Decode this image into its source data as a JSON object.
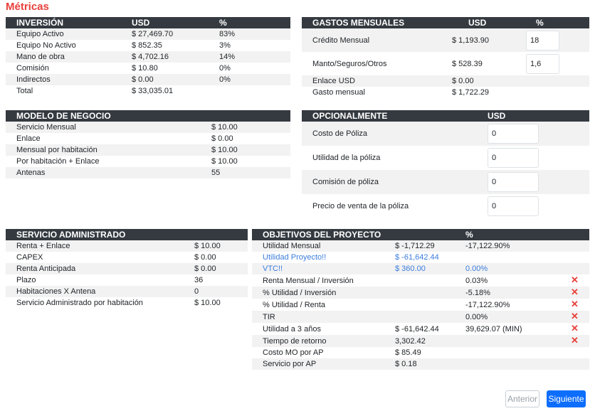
{
  "page_title": "Métricas",
  "inversion": {
    "headers": [
      "INVERSIÓN",
      "USD",
      "%"
    ],
    "rows": [
      [
        "Equipo Activo",
        "$ 27,469.70",
        "83%"
      ],
      [
        "Equipo No Activo",
        "$ 852.35",
        "3%"
      ],
      [
        "Mano de obra",
        "$ 4,702.16",
        "14%"
      ],
      [
        "Comisión",
        "$ 10.80",
        "0%"
      ],
      [
        "Indirectos",
        "$ 0.00",
        "0%"
      ],
      [
        "Total",
        "$ 33,035.01",
        ""
      ]
    ]
  },
  "gastos": {
    "headers": [
      "GASTOS MENSUALES",
      "USD",
      "%"
    ],
    "credito_label": "Crédito Mensual",
    "credito_usd": "$ 1,193.90",
    "credito_pct": "18",
    "manto_label": "Manto/Seguros/Otros",
    "manto_usd": "$ 528.39",
    "manto_pct": "1,6",
    "enlace_label": "Enlace USD",
    "enlace_usd": "$ 0.00",
    "gasto_label": "Gasto mensual",
    "gasto_usd": "$ 1,722.29"
  },
  "modelo": {
    "headers": [
      "MODELO DE NEGOCIO"
    ],
    "rows": [
      [
        "Servicio Mensual",
        "$ 10.00"
      ],
      [
        "Enlace",
        "$ 0.00"
      ],
      [
        "Mensual por habitación",
        "$ 10.00"
      ],
      [
        "Por habitación + Enlace",
        "$ 10.00"
      ],
      [
        "Antenas",
        "55"
      ]
    ]
  },
  "opcional": {
    "headers": [
      "OPCIONALMENTE",
      "USD"
    ],
    "rows": [
      [
        "Costo de Póliza",
        "0"
      ],
      [
        "Utilidad de la póliza",
        "0"
      ],
      [
        "Comisión de póliza",
        "0"
      ],
      [
        "Precio de venta de la póliza",
        "0"
      ]
    ]
  },
  "servicio": {
    "headers": [
      "SERVICIO ADMINISTRADO"
    ],
    "rows": [
      [
        "Renta + Enlace",
        "$ 10.00"
      ],
      [
        "CAPEX",
        "$ 0.00"
      ],
      [
        "Renta Anticipada",
        "$ 0.00"
      ],
      [
        "Plazo",
        "36"
      ],
      [
        "Habitaciones X Antena",
        "0"
      ],
      [
        "Servicio Administrado por habitación",
        "$ 10.00"
      ]
    ]
  },
  "objetivos": {
    "headers": [
      "OBJETIVOS DEL PROYECTO",
      "",
      "%"
    ],
    "rows": [
      [
        "Utilidad Mensual",
        "$ -1,712.29",
        "-17,122.90%"
      ],
      [
        "Utilidad Proyecto!!",
        "$ -61,642.44",
        ""
      ],
      [
        "VTC!!",
        "$ 360.00",
        "0.00%"
      ],
      [
        "Renta Mensual / Inversión",
        "",
        "0.03%"
      ],
      [
        "% Utilidad / Inversión",
        "",
        "-5.18%"
      ],
      [
        "% Utilidad / Renta",
        "",
        "-17,122.90%"
      ],
      [
        "TIR",
        "",
        "0.00%"
      ],
      [
        "Utilidad a 3 años",
        "$ -61,642.44",
        "39,629.07 (MIN)"
      ],
      [
        "Tiempo de retorno",
        "3,302.42",
        ""
      ],
      [
        "Costo MO por AP",
        "$ 85.49",
        ""
      ],
      [
        "Servicio por AP",
        "$ 0.18",
        ""
      ]
    ],
    "x_mark": "✕"
  },
  "buttons": {
    "prev": "Anterior",
    "next": "Siguiente"
  },
  "colors": {
    "title": "#e8403a",
    "header_bg": "#343a40",
    "link_blue": "#3b7ddd",
    "primary": "#0d6efd",
    "error_x": "#e8403a"
  }
}
